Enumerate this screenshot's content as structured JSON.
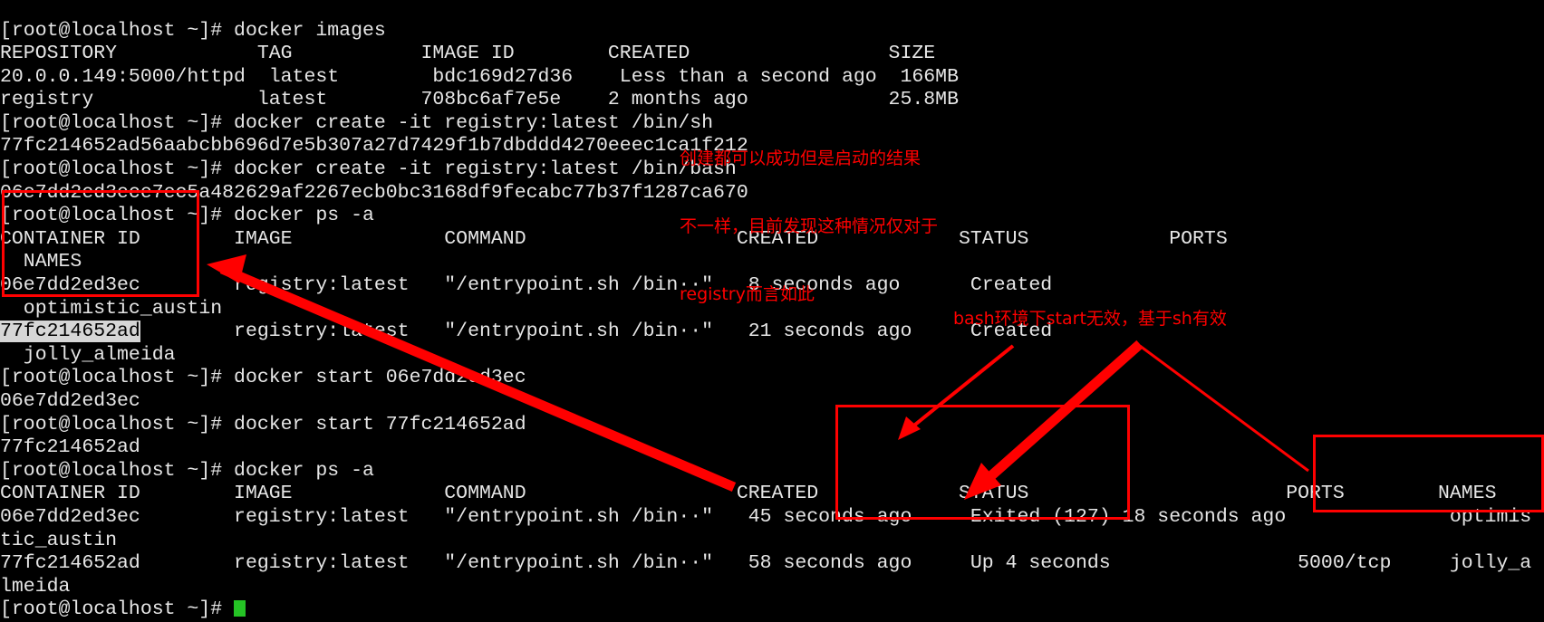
{
  "terminal": {
    "prompt": "[root@localhost ~]#",
    "colors": {
      "background": "#000000",
      "foreground": "#e6e6e6",
      "annotation": "#ff0000",
      "cursor": "#25c325",
      "selection_bg": "#d6d6d6"
    },
    "lines": [
      {
        "id": "l00",
        "text": "[root@localhost ~]# docker images"
      },
      {
        "id": "l01",
        "text": "REPOSITORY            TAG           IMAGE ID        CREATED                 SIZE"
      },
      {
        "id": "l02",
        "text": "20.0.0.149:5000/httpd  latest        bdc169d27d36    Less than a second ago  166MB"
      },
      {
        "id": "l03",
        "text": "registry              latest        708bc6af7e5e    2 months ago            25.8MB"
      },
      {
        "id": "l04",
        "text": "[root@localhost ~]# docker create -it registry:latest /bin/sh"
      },
      {
        "id": "l05",
        "text": "77fc214652ad56aabcbb696d7e5b307a27d7429f1b7dbddd4270eeec1ca1f212"
      },
      {
        "id": "l06",
        "text": "[root@localhost ~]# docker create -it registry:latest /bin/bash"
      },
      {
        "id": "l07",
        "text": "06e7dd2ed3ece7ec5a482629af2267ecb0bc3168df9fecabc77b37f1287ca670"
      },
      {
        "id": "l08",
        "text": "[root@localhost ~]# docker ps -a"
      },
      {
        "id": "l09",
        "text": "CONTAINER ID        IMAGE             COMMAND                  CREATED            STATUS            PORTS"
      },
      {
        "id": "l10",
        "text": "  NAMES"
      },
      {
        "id": "l11",
        "text": "06e7dd2ed3ec        registry:latest   \"/entrypoint.sh /bin··\"   8 seconds ago      Created"
      },
      {
        "id": "l12",
        "text": "  optimistic_austin"
      },
      {
        "id": "l13a",
        "text": "77fc214652ad",
        "selected": true
      },
      {
        "id": "l13b",
        "text": "        registry:latest   \"/entrypoint.sh /bin··\"   21 seconds ago     Created"
      },
      {
        "id": "l14",
        "text": "  jolly_almeida"
      },
      {
        "id": "l15",
        "text": "[root@localhost ~]# docker start 06e7dd2ed3ec"
      },
      {
        "id": "l16",
        "text": "06e7dd2ed3ec"
      },
      {
        "id": "l17",
        "text": "[root@localhost ~]# docker start 77fc214652ad"
      },
      {
        "id": "l18",
        "text": "77fc214652ad"
      },
      {
        "id": "l19",
        "text": "[root@localhost ~]# docker ps -a"
      },
      {
        "id": "l20",
        "text": "CONTAINER ID        IMAGE             COMMAND                  CREATED            STATUS                      PORTS        NAMES"
      },
      {
        "id": "l21",
        "text": "06e7dd2ed3ec        registry:latest   \"/entrypoint.sh /bin··\"   45 seconds ago     Exited (127) 18 seconds ago              optimis"
      },
      {
        "id": "l22",
        "text": "tic_austin"
      },
      {
        "id": "l23",
        "text": "77fc214652ad        registry:latest   \"/entrypoint.sh /bin··\"   58 seconds ago     Up 4 seconds                5000/tcp     jolly_a"
      },
      {
        "id": "l24",
        "text": "lmeida"
      },
      {
        "id": "l25",
        "text": "[root@localhost ~]# "
      }
    ]
  },
  "annotations": {
    "note_create": {
      "name": "create-result-note",
      "lines": [
        "创建都可以成功但是启动的结果",
        "不一样，目前发现这种情况仅对于",
        "registry而言如此"
      ]
    },
    "note_bash": {
      "name": "bash-start-note",
      "text": "bash环境下start无效，基于sh有效"
    }
  }
}
